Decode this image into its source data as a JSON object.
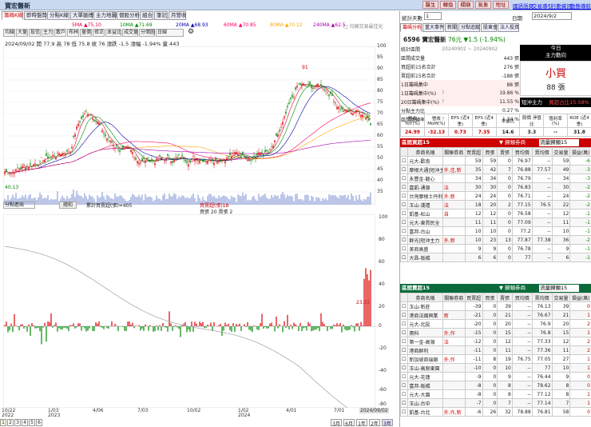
{
  "app": {
    "title": "寶宏醫新",
    "buttons": [
      "醫生",
      "轉換",
      "欄廟",
      "氣象",
      "地址"
    ],
    "links": [
      "國語語頁",
      "交易導引",
      "行動資訊",
      "動態導航"
    ]
  },
  "main_tabs": [
    "籌碼K線",
    "即時盤勢",
    "分點K線",
    "大單脈搏",
    "主力地圖",
    "個股分析",
    "組合",
    "筆記",
    "月營收"
  ],
  "toolbar": [
    "均線",
    "大量",
    "投信",
    "主力",
    "散戶",
    "布林",
    "量價",
    "修正",
    "本益比",
    "成交量",
    "分價圖",
    "日線"
  ],
  "ma_legend": [
    {
      "label": "5MA ▲75.10",
      "color": "#d04"
    },
    {
      "label": "10MA ▲71.69",
      "color": "#080"
    },
    {
      "label": "20MA ▲68.93",
      "color": "#00a"
    },
    {
      "label": "60MA ▲70.85",
      "color": "#f06"
    },
    {
      "label": "80MA ▲70.12",
      "color": "#fa0"
    },
    {
      "label": "240MA ▲62.5",
      "color": "#a0a"
    },
    {
      "label": "□ 均線交易最佳化",
      "color": "#888"
    }
  ],
  "price_info": "2024/09/02 開 77.9 高 78 低 75.8 收 76  漲跌 -1.5  漲幅 -1.94%  量 443",
  "price_axis": [
    "100",
    "95",
    "90",
    "85",
    "80",
    "75",
    "70",
    "65",
    "60",
    "55",
    "50",
    "45",
    "40",
    "35"
  ],
  "peak_label": "91",
  "low_label": "40.13",
  "lower_panel": {
    "selector": "分點進出",
    "button": "總和",
    "legend1": "累計買賣超(張)=405",
    "legend2": "買賣超(張)18",
    "legend3": "買張 20 賣張 2",
    "axis": [
      "100",
      "80",
      "60",
      "40",
      "20",
      "0",
      "-20",
      "-40",
      "-60",
      "-80"
    ],
    "last_value": "23.35"
  },
  "x_axis": [
    {
      "d": "10/22",
      "y": "2022"
    },
    {
      "d": "1/03",
      "y": "2023"
    },
    {
      "d": "4/06",
      "y": ""
    },
    {
      "d": "7/03",
      "y": ""
    },
    {
      "d": "10/02",
      "y": ""
    },
    {
      "d": "1/02",
      "y": "2024"
    },
    {
      "d": "4/01",
      "y": ""
    },
    {
      "d": "7/01",
      "y": ""
    }
  ],
  "x_current": "2024/09/02",
  "pager": [
    "1",
    "2",
    "3",
    "4",
    "5",
    "6"
  ],
  "range_btns": [
    "3月",
    "6月",
    "1年",
    "2年",
    "3年"
  ],
  "right": {
    "days_label": "統計天數",
    "days_value": "1",
    "date_label": "日期",
    "date_value": "2024/9/2",
    "tabs": [
      "籌碼分析",
      "重大事件",
      "新聞",
      "分點追蹤",
      "股東會",
      "法人投資"
    ],
    "stock": "6596 寶宏醫新",
    "price": "76元 ▼1.5 (-1.94%)",
    "stats": [
      [
        "統計區間",
        "20240902 ~ 20240902",
        ""
      ],
      [
        "區間成交量",
        "",
        "443 張"
      ],
      [
        "買超前15名合計",
        "",
        "276 張"
      ],
      [
        "賣超前15名合計",
        "",
        "-188 張"
      ],
      [
        "1日籌碼集中",
        "",
        "88 張"
      ],
      [
        "1日籌碼集中(%)",
        "?",
        "19.86 %"
      ],
      [
        "20日籌碼集中(%)",
        "?",
        "11.55 %"
      ],
      [
        "分點主力比",
        "",
        "0.27 %"
      ],
      [
        "區間周轉率",
        "?",
        "1.34 %"
      ]
    ],
    "today_title": "今日",
    "today_sub": "主力動向",
    "today_action": "小買",
    "today_qty": "88 張",
    "hedge_label": "短沖主力",
    "hedge_value": "買超占比15.58%",
    "fin_headers": [
      "營收 YoY(%)",
      "營收 MoM(%)",
      "EPS (近4季)",
      "EPS (近4季)",
      "本益比",
      "股價 淨值比",
      "殖利率 (%)",
      "ROE (近4季)"
    ],
    "fin_values": [
      "24.99",
      "-32.13",
      "0.73",
      "7.35",
      "14.6",
      "3.3",
      "--",
      "31.8"
    ],
    "buy_title": "區間買超15",
    "sell_title": "區間賣超15",
    "filter_label": "▼ 歸類券商",
    "filter_value": "流量歸類15",
    "col_headers": [
      "",
      "券商名稱",
      "關聯券商",
      "買賣超",
      "買張",
      "賣張",
      "買均價",
      "賣均價",
      "交易量",
      "損益(萬)"
    ],
    "buy_rows": [
      [
        "元大-歡南",
        "",
        "59",
        "59",
        "0",
        "76.97",
        "--",
        "59",
        "-6"
      ],
      [
        "摩根大通|短沖主力",
        "外,佳,新",
        "35",
        "42",
        "7",
        "76.88",
        "77.57",
        "49",
        "-3"
      ],
      [
        "永豐金-龍心",
        "",
        "34",
        "34",
        "0",
        "76.79",
        "--",
        "34",
        "-3"
      ],
      [
        "嘉凱-湧源",
        "法",
        "30",
        "30",
        "0",
        "76.83",
        "--",
        "30",
        "-2"
      ],
      [
        "台灣摩根士丹利|短沖主力",
        "外,新",
        "24",
        "24",
        "0",
        "76.71",
        "--",
        "24",
        "-2"
      ],
      [
        "玉山-漢禮",
        "法",
        "18",
        "20",
        "2",
        "77.15",
        "76.5",
        "22",
        "-2"
      ],
      [
        "凱基-松山",
        "自",
        "12",
        "12",
        "0",
        "76.58",
        "--",
        "12",
        "-1"
      ],
      [
        "元大-東貫民全",
        "",
        "11",
        "11",
        "0",
        "77.09",
        "--",
        "11",
        "-1"
      ],
      [
        "富邦-台山",
        "",
        "10",
        "10",
        "0",
        "77.2",
        "--",
        "10",
        "-1"
      ],
      [
        "群光|短沖主力",
        "外,新",
        "10",
        "23",
        "13",
        "77.87",
        "77.38",
        "36",
        "-2"
      ],
      [
        "美商高盛",
        "",
        "9",
        "9",
        "0",
        "76.78",
        "--",
        "9",
        "-1"
      ],
      [
        "大昌-板橋",
        "",
        "6",
        "6",
        "0",
        "77",
        "--",
        "6",
        "-1"
      ]
    ],
    "sell_rows": [
      [
        "玉山-新莊",
        "",
        "-39",
        "0",
        "39",
        "--",
        "76.13",
        "39",
        "0"
      ],
      [
        "港商法國興業",
        "新",
        "-21",
        "0",
        "21",
        "--",
        "76.67",
        "21",
        "1"
      ],
      [
        "元大-北投",
        "",
        "-20",
        "0",
        "20",
        "--",
        "76.9",
        "20",
        "2"
      ],
      [
        "奧科",
        "外,作",
        "-15",
        "0",
        "15",
        "--",
        "76.8",
        "15",
        "1"
      ],
      [
        "第一金-高領",
        "法",
        "-12",
        "0",
        "12",
        "--",
        "77.33",
        "12",
        "2"
      ],
      [
        "港商群利",
        "",
        "-11",
        "0",
        "11",
        "--",
        "77.36",
        "11",
        "2"
      ],
      [
        "新加坡商瑞銀",
        "外,作",
        "-11",
        "8",
        "19",
        "76.75",
        "77.05",
        "27",
        "1"
      ],
      [
        "玉山-高原東園",
        "",
        "-10",
        "0",
        "10",
        "--",
        "77",
        "10",
        "1"
      ],
      [
        "元大-花蓮",
        "",
        "-9",
        "0",
        "9",
        "--",
        "76.44",
        "9",
        "0"
      ],
      [
        "富邦-板橋",
        "",
        "-8",
        "0",
        "8",
        "--",
        "78.62",
        "8",
        "0"
      ],
      [
        "元大-大園",
        "",
        "-8",
        "0",
        "8",
        "--",
        "77.12",
        "8",
        "1"
      ],
      [
        "玉山-台中",
        "",
        "-7",
        "0",
        "7",
        "--",
        "77.14",
        "7",
        "1"
      ],
      [
        "凱基-台北",
        "外,作,新",
        "-6",
        "26",
        "32",
        "78.88",
        "76.81",
        "58",
        "0"
      ]
    ]
  },
  "colors": {
    "up": "#d00",
    "down": "#080",
    "header_red": "#c00",
    "header_green": "#0a6a3a"
  }
}
